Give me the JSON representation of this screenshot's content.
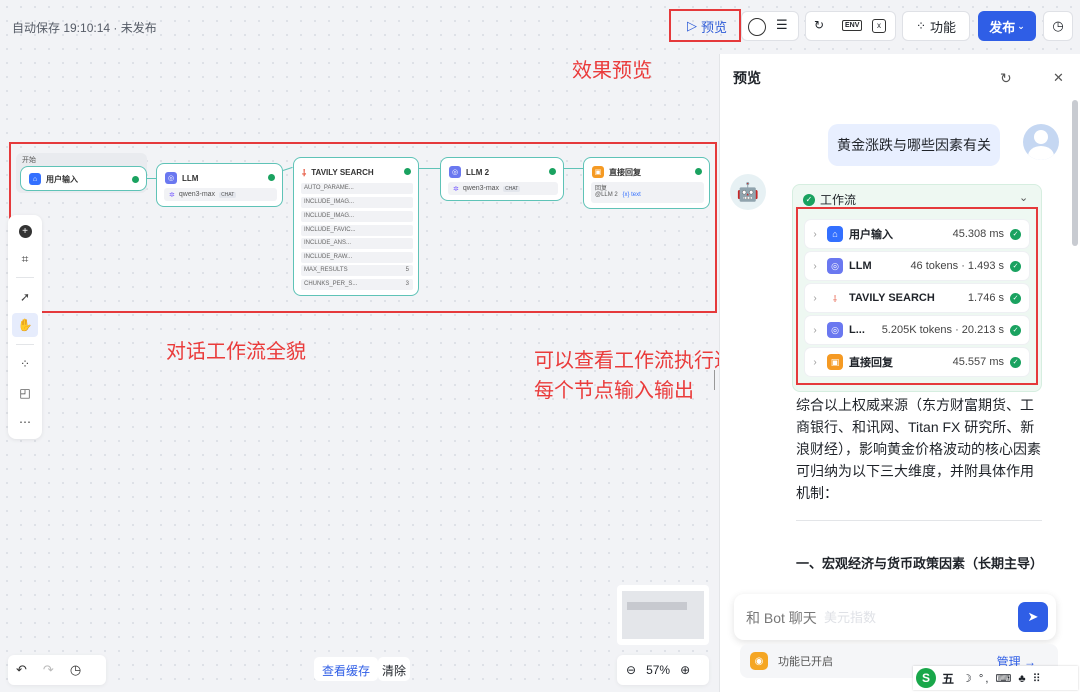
{
  "header": {
    "autosave": "自动保存 19:10:14 · 未发布",
    "preview_label": "预览",
    "function_label": "功能",
    "publish_label": "发布",
    "env_label": "ENV"
  },
  "annotations": {
    "preview_effect": "效果预览",
    "workflow_overview": "对话工作流全貌",
    "process_line1": "可以查看工作流执行过程，",
    "process_line2": "每个节点输入输出"
  },
  "canvas": {
    "start_label": "开始",
    "nodes": {
      "user_input": "用户输入",
      "llm1": "LLM",
      "llm1_model": "qwen3-max",
      "llm1_tag": "CHAT",
      "tavily": "TAVILY SEARCH",
      "llm2": "LLM 2",
      "llm2_model": "qwen3-max",
      "llm2_tag": "CHAT",
      "reply": "直接回复",
      "reply_sub": "回复",
      "reply_ref": "@LLM 2",
      "reply_var": "{x} text"
    },
    "tavily_params": [
      {
        "name": "AUTO_PARAME...",
        "value": ""
      },
      {
        "name": "INCLUDE_IMAG...",
        "value": ""
      },
      {
        "name": "INCLUDE_IMAG...",
        "value": ""
      },
      {
        "name": "INCLUDE_FAVIC...",
        "value": ""
      },
      {
        "name": "INCLUDE_ANS...",
        "value": ""
      },
      {
        "name": "INCLUDE_RAW...",
        "value": ""
      },
      {
        "name": "MAX_RESULTS",
        "value": "5"
      },
      {
        "name": "CHUNKS_PER_S...",
        "value": "3"
      }
    ]
  },
  "bottom": {
    "view_cache": "查看缓存",
    "clear": "清除",
    "zoom": "57%"
  },
  "preview_panel": {
    "title": "预览",
    "user_message": "黄金涨跌与哪些因素有关",
    "workflow_label": "工作流",
    "steps": [
      {
        "name": "用户输入",
        "metric": "45.308 ms",
        "icon": "home-icon",
        "color": "#3370ff"
      },
      {
        "name": "LLM",
        "metric": "46 tokens · 1.493 s",
        "icon": "llm-icon",
        "color": "#6a78f0"
      },
      {
        "name": "TAVILY SEARCH",
        "metric": "1.746 s",
        "icon": "tavily-icon",
        "color": "#ffffff"
      },
      {
        "name": "L...",
        "metric": "5.205K tokens · 20.213 s",
        "icon": "llm-icon",
        "color": "#6a78f0"
      },
      {
        "name": "直接回复",
        "metric": "45.557 ms",
        "icon": "reply-icon",
        "color": "#f59a23"
      }
    ],
    "answer_p1": "综合以上权威来源（东方财富期货、工商银行、和讯网、Titan FX 研究所、新浪财经），影响黄金价格波动的核心因素可归纳为以下三大维度，并附具体作用机制：",
    "answer_h1": "一、宏观经济与货币政策因素（长期主导）",
    "input_placeholder": "和 Bot 聊天",
    "input_ghost": "美元指数",
    "feature_status": "功能已开启",
    "manage_label": "管理 →"
  },
  "ime": {
    "label": "五",
    "icons": "☽ °, ⌨ ♣ ⠿"
  },
  "colors": {
    "accent": "#2f5ee6",
    "annotation_red": "#e5393b",
    "node_border": "#5fc3b7",
    "success": "#1aa260"
  }
}
